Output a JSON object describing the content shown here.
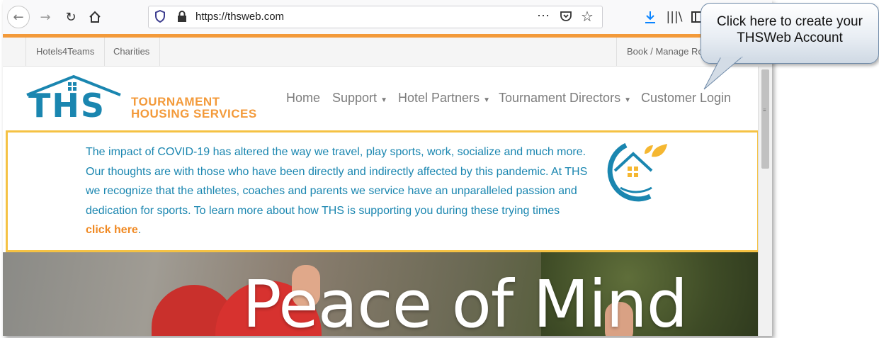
{
  "browser": {
    "url": "https://thsweb.com",
    "icons": [
      "back-arrow-icon",
      "forward-arrow-icon",
      "reload-icon",
      "home-icon",
      "shield-icon",
      "lock-icon",
      "more-icon",
      "pocket-icon",
      "star-icon",
      "download-icon",
      "library-icon",
      "reader-icon"
    ]
  },
  "topbar": {
    "links": [
      "Hotels4Teams",
      "Charities"
    ],
    "right_link": "Book / Manage Ro"
  },
  "logo": {
    "mark": "THS",
    "line1": "TOURNAMENT",
    "line2": "HOUSING SERVICES"
  },
  "nav": {
    "home": "Home",
    "support": "Support",
    "hotel_partners": "Hotel Partners",
    "tournament_directors": "Tournament Directors",
    "customer_login": "Customer Login"
  },
  "covid": {
    "line1": "The impact of COVID-19 has altered the way we travel, play sports, work, socialize and much more.",
    "line2": "Our thoughts are with those who have been directly and indirectly affected by this pandemic. At THS",
    "line3": "we recognize that the athletes, coaches and parents we service have an unparalleled passion and",
    "line4": "dedication for sports. To learn more about how THS is supporting you during these trying times",
    "link": "click here",
    "link_suffix": "."
  },
  "hero": {
    "title": "Peace of Mind"
  },
  "callout": {
    "line1": "Click here to create your",
    "line2": "THSWeb Account"
  },
  "colors": {
    "accent_orange": "#f39a3a",
    "brand_blue": "#1a86b0",
    "border_yellow": "#f5c244"
  }
}
